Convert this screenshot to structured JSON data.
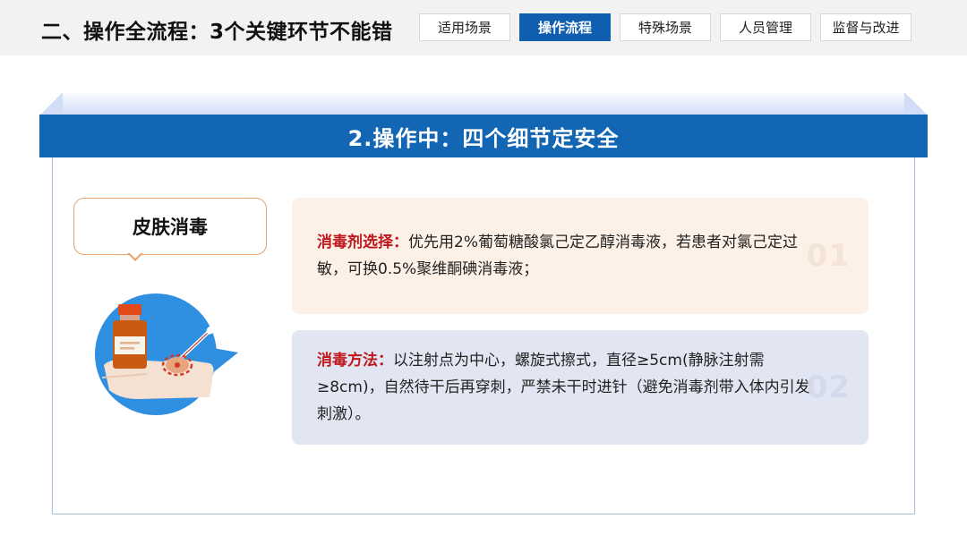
{
  "header": {
    "title": "二、操作全流程：3个关键环节不能错",
    "tabs": [
      {
        "label": "适用场景",
        "active": false
      },
      {
        "label": "操作流程",
        "active": true
      },
      {
        "label": "特殊场景",
        "active": false
      },
      {
        "label": "人员管理",
        "active": false
      },
      {
        "label": "监督与改进",
        "active": false
      }
    ]
  },
  "banner": {
    "title": "2.操作中：四个细节定安全"
  },
  "section": {
    "label": "皮肤消毒"
  },
  "cards": [
    {
      "label": "消毒剂选择：",
      "text": "优先用2%葡萄糖酸氯己定乙醇消毒液，若患者对氯己定过敏，可换0.5%聚维酮碘消毒液；",
      "number": "01"
    },
    {
      "label": "消毒方法：",
      "text": "以注射点为中心，螺旋式擦式，直径≥5cm(静脉注射需≥8cm)，自然待干后再穿刺，严禁未干时进针（避免消毒剂带入体内引发刺激）。",
      "number": "02"
    }
  ],
  "colors": {
    "accent_blue": "#1366b3",
    "tab_active": "#0f5fae",
    "label_red": "#c0171d",
    "card1_bg": "#fdf0e6",
    "card2_bg": "#e2e6f3",
    "bubble_border": "#e8a46a"
  },
  "icons": {
    "illustration": "disinfect-skin-illustration-icon"
  }
}
